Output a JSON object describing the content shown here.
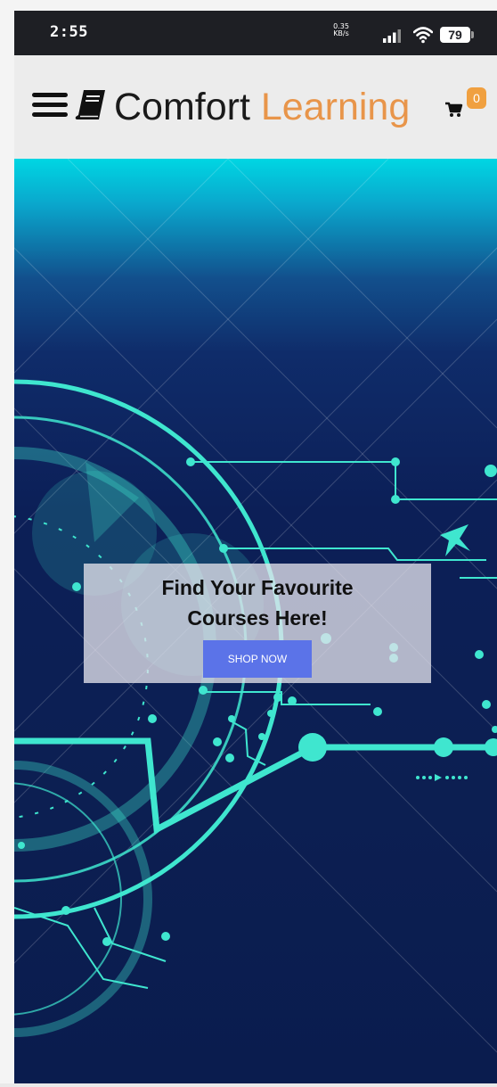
{
  "status_bar": {
    "time": "2:55",
    "net_speed_value": "0.35",
    "net_speed_unit": "KB/s",
    "battery_level": "79",
    "icons": [
      "signal-icon",
      "wifi-icon",
      "battery-icon"
    ]
  },
  "header": {
    "brand_part_1": "Comfort",
    "brand_part_2": "Learning",
    "cart_count": "0",
    "icons": [
      "menu-icon",
      "book-icon",
      "cart-icon"
    ],
    "colors": {
      "brand_accent": "#e8954a",
      "badge": "#f0a040",
      "header_bg": "#ececec"
    }
  },
  "hero": {
    "title_line_1": "Find Your Favourite",
    "title_line_2": "Courses Here!",
    "cta_label": "SHOP NOW",
    "colors": {
      "cta": "#5b73e8",
      "circuit": "#3fe6cf",
      "background_top": "#00d6e3",
      "background_main": "#0c1f52"
    }
  }
}
